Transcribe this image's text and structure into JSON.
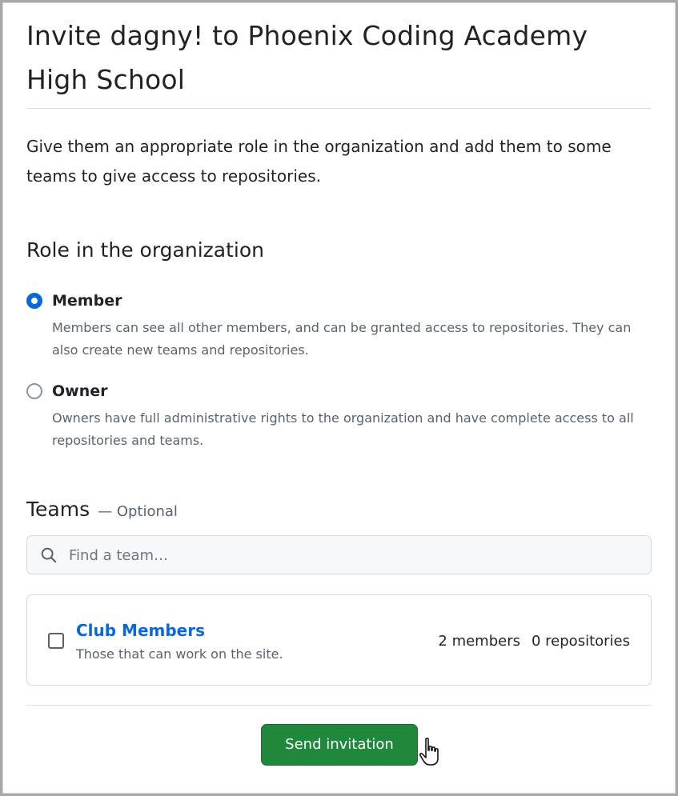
{
  "header": {
    "title": "Invite dagny! to Phoenix Coding Academy High School",
    "intro": "Give them an appropriate role in the organization and add them to some teams to give access to repositories."
  },
  "role": {
    "heading": "Role in the organization",
    "options": [
      {
        "label": "Member",
        "description": "Members can see all other members, and can be granted access to repositories. They can also create new teams and repositories.",
        "checked": true
      },
      {
        "label": "Owner",
        "description": "Owners have full administrative rights to the organization and have complete access to all repositories and teams.",
        "checked": false
      }
    ]
  },
  "teams": {
    "heading": "Teams",
    "optional": "— Optional",
    "search": {
      "placeholder": "Find a team…",
      "value": ""
    },
    "items": [
      {
        "name": "Club Members",
        "description": "Those that can work on the site.",
        "members": "2 members",
        "repositories": "0 repositories",
        "checked": false
      }
    ]
  },
  "actions": {
    "send_label": "Send invitation"
  },
  "colors": {
    "accent": "#0969da",
    "primary_button": "#1f883d",
    "muted_text": "#59636e"
  }
}
